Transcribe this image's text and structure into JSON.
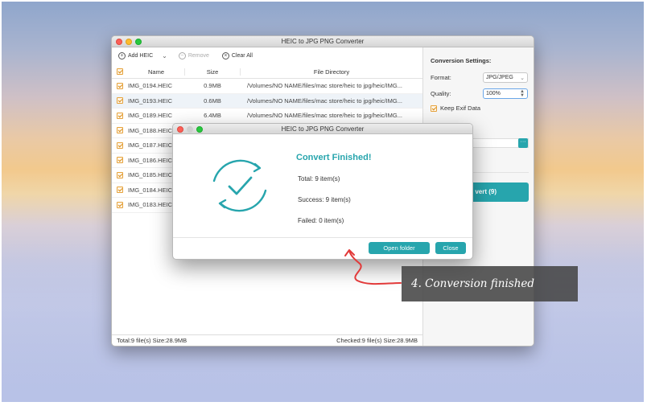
{
  "main_window": {
    "title": "HEIC to JPG PNG Converter",
    "toolbar": {
      "add_label": "Add HEIC",
      "remove_label": "Remove",
      "clear_label": "Clear All"
    },
    "columns": {
      "name": "Name",
      "size": "Size",
      "dir": "File Directory"
    },
    "rows": [
      {
        "name": "IMG_0194.HEIC",
        "size": "0.9MB",
        "dir": "/Volumes/NO NAME/files/mac store/heic to jpg/heic/IMG..."
      },
      {
        "name": "IMG_0193.HEIC",
        "size": "0.6MB",
        "dir": "/Volumes/NO NAME/files/mac store/heic to jpg/heic/IMG..."
      },
      {
        "name": "IMG_0189.HEIC",
        "size": "6.4MB",
        "dir": "/Volumes/NO NAME/files/mac store/heic to jpg/heic/IMG..."
      },
      {
        "name": "IMG_0188.HEIC",
        "size": "",
        "dir": ""
      },
      {
        "name": "IMG_0187.HEIC",
        "size": "",
        "dir": ""
      },
      {
        "name": "IMG_0186.HEIC",
        "size": "",
        "dir": ""
      },
      {
        "name": "IMG_0185.HEIC",
        "size": "",
        "dir": ""
      },
      {
        "name": "IMG_0184.HEIC",
        "size": "",
        "dir": ""
      },
      {
        "name": "IMG_0183.HEIC",
        "size": "",
        "dir": ""
      }
    ],
    "status_left": "Total:9 file(s) Size:28.9MB",
    "status_right": "Checked:9 file(s) Size:28.9MB",
    "settings": {
      "title": "Conversion Settings:",
      "format_label": "Format:",
      "format_value": "JPG/JPEG",
      "quality_label": "Quality:",
      "quality_value": "100%",
      "exif_label": "Keep Exif Data",
      "convert_label": "vert (9)"
    }
  },
  "dialog": {
    "title": "HEIC to JPG PNG Converter",
    "heading": "Convert Finished!",
    "total": "Total: 9 item(s)",
    "success": "Success: 9 item(s)",
    "failed": "Failed: 0 item(s)",
    "open_folder_label": "Open folder",
    "close_label": "Close"
  },
  "annotation": "4. Conversion finished",
  "colors": {
    "accent": "#27a5ad",
    "checkbox": "#e6a23b",
    "callout_bg": "#464646"
  }
}
